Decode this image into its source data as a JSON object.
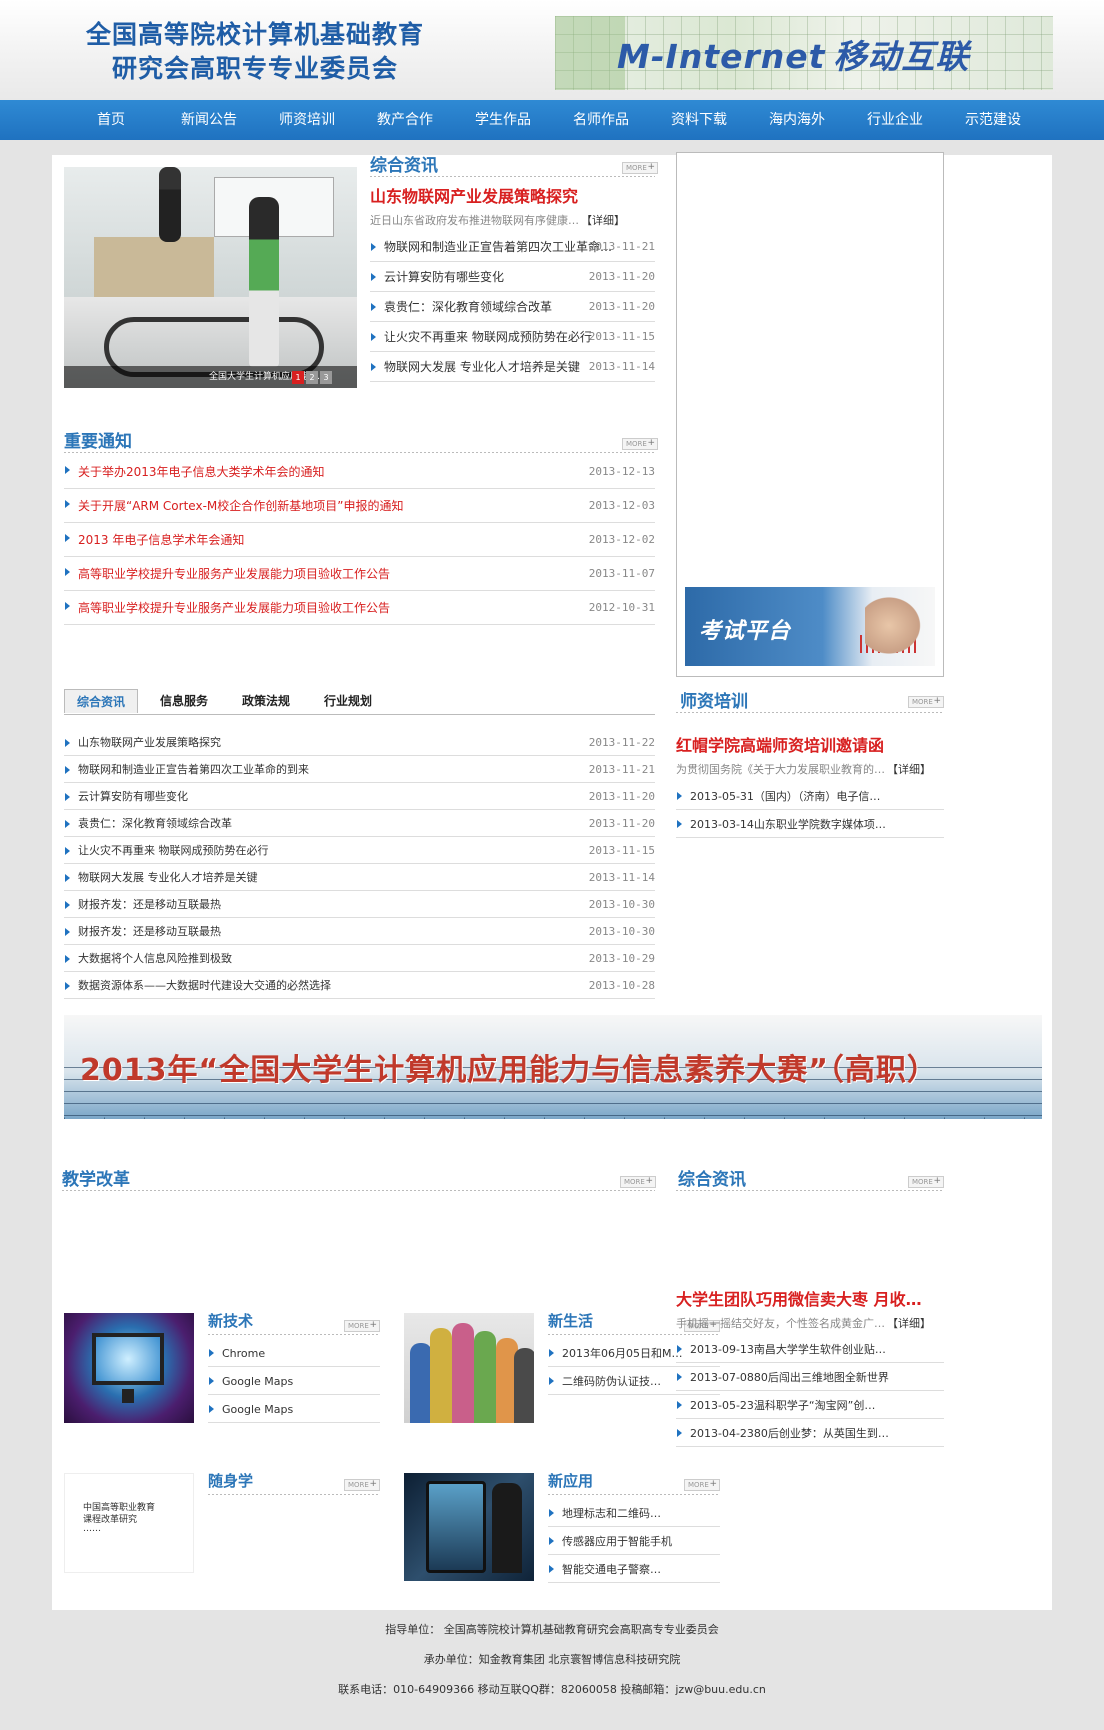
{
  "header": {
    "title_line1": "全国高等院校计算机基础教育",
    "title_line2": "研究会高职专专业委员会",
    "brand_en": "M-Internet",
    "brand_cn": "移动互联"
  },
  "nav": [
    "首页",
    "新闻公告",
    "师资培训",
    "教产合作",
    "学生作品",
    "名师作品",
    "资料下载",
    "海内海外",
    "行业企业",
    "示范建设"
  ],
  "more_label": "MORE",
  "slideshow": {
    "caption": "全国大学生计算机应用能力...",
    "pages": [
      "1",
      "2",
      "3"
    ]
  },
  "news": {
    "title": "综合资讯",
    "headline": "山东物联网产业发展策略探究",
    "summary": "近日山东省政府发布推进物联网有序健康…",
    "detail": "【详细】",
    "items": [
      {
        "t": "物联网和制造业正宣告着第四次工业革命…",
        "d": "2013-11-21"
      },
      {
        "t": "云计算安防有哪些变化",
        "d": "2013-11-20"
      },
      {
        "t": "袁贵仁：深化教育领域综合改革",
        "d": "2013-11-20"
      },
      {
        "t": "让火灾不再重来 物联网成预防势在必行",
        "d": "2013-11-15"
      },
      {
        "t": "物联网大发展 专业化人才培养是关键",
        "d": "2013-11-14"
      }
    ]
  },
  "notices": {
    "title": "重要通知",
    "items": [
      {
        "t": "关于举办2013年电子信息大类学术年会的通知",
        "d": "2013-12-13"
      },
      {
        "t": "关于开展“ARM Cortex-M校企合作创新基地项目”申报的通知",
        "d": "2013-12-03"
      },
      {
        "t": "2013 年电子信息学术年会通知",
        "d": "2013-12-02"
      },
      {
        "t": "高等职业学校提升专业服务产业发展能力项目验收工作公告",
        "d": "2013-11-07"
      },
      {
        "t": "高等职业学校提升专业服务产业发展能力项目验收工作公告",
        "d": "2012-10-31"
      }
    ]
  },
  "exam": {
    "label": "考试平台"
  },
  "tabs": [
    "综合资讯",
    "信息服务",
    "政策法规",
    "行业规划"
  ],
  "tab_items": [
    {
      "t": "山东物联网产业发展策略探究",
      "d": "2013-11-22"
    },
    {
      "t": "物联网和制造业正宣告着第四次工业革命的到来",
      "d": "2013-11-21"
    },
    {
      "t": "云计算安防有哪些变化",
      "d": "2013-11-20"
    },
    {
      "t": "袁贵仁：深化教育领域综合改革",
      "d": "2013-11-20"
    },
    {
      "t": "让火灾不再重来 物联网成预防势在必行",
      "d": "2013-11-15"
    },
    {
      "t": "物联网大发展 专业化人才培养是关键",
      "d": "2013-11-14"
    },
    {
      "t": "财报齐发：还是移动互联最热",
      "d": "2013-10-30"
    },
    {
      "t": "财报齐发：还是移动互联最热",
      "d": "2013-10-30"
    },
    {
      "t": "大数据将个人信息风险推到极致",
      "d": "2013-10-29"
    },
    {
      "t": "数据资源体系——大数据时代建设大交通的必然选择",
      "d": "2013-10-28"
    }
  ],
  "training": {
    "title": "师资培训",
    "headline": "红帽学院高端师资培训邀请函",
    "summary": "为贯彻国务院《关于大力发展职业教育的…",
    "detail": "【详细】",
    "items": [
      "2013-05-31（国内）（济南）电子信…",
      "2013-03-14山东职业学院数字媒体项…"
    ]
  },
  "banner": {
    "text": "2013年“全国大学生计算机应用能力与信息素养大赛”（高职）"
  },
  "reform": {
    "title": "教学改革",
    "tech": {
      "title": "新技术",
      "items": [
        "Chrome",
        "Google Maps",
        "Google Maps"
      ]
    },
    "life": {
      "title": "新生活",
      "items": [
        "2013年06月05日和M…",
        "二维码防伪认证技…"
      ]
    },
    "study": {
      "title": "随身学",
      "cover_lines": [
        "中国高等职业教育",
        "课程改革研究",
        "……"
      ]
    },
    "app": {
      "title": "新应用",
      "items": [
        "地理标志和二维码…",
        "传感器应用于智能手机",
        "智能交通电子警察…"
      ]
    }
  },
  "news2": {
    "title": "综合资讯",
    "headline": "大学生团队巧用微信卖大枣 月收…",
    "summary": "手机摇一摇结交好友，个性签名成黄金广…",
    "detail": "【详细】",
    "items": [
      "2013-09-13南昌大学学生软件创业贴…",
      "2013-07-0880后闯出三维地图全新世界",
      "2013-05-23温科职学子“淘宝网”创…",
      "2013-04-2380后创业梦：从英国生到…"
    ]
  },
  "footer": {
    "line1": "指导单位：  全国高等院校计算机基础教育研究会高职高专专业委员会",
    "line2": "承办单位：知金教育集团 北京寰智博信息科技研究院",
    "line3": "联系电话：010-64909366 移动互联QQ群：82060058 投稿邮箱：jzw@buu.edu.cn"
  }
}
